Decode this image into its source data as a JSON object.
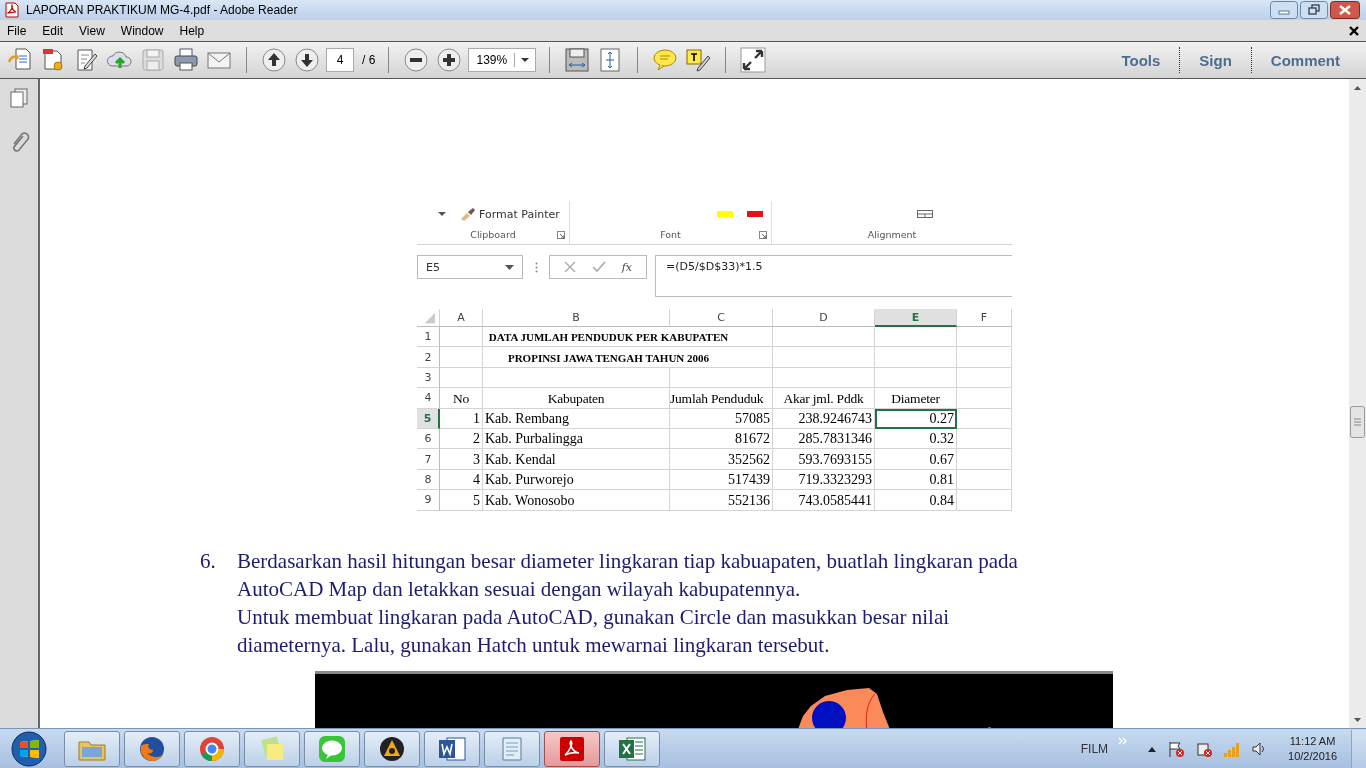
{
  "window": {
    "title": "LAPORAN PRAKTIKUM MG-4.pdf - Adobe Reader"
  },
  "menu": [
    "File",
    "Edit",
    "View",
    "Window",
    "Help"
  ],
  "toolbar": {
    "page": "4",
    "page_total": "/ 6",
    "zoom": "139%",
    "panes": [
      "Tools",
      "Sign",
      "Comment"
    ]
  },
  "document": {
    "spreadsheet": {
      "ribbon": {
        "clipboard_button": "Format Painter",
        "groups": [
          "Clipboard",
          "Font",
          "Alignment"
        ]
      },
      "name_box": "E5",
      "function_label": "fx",
      "formula": "=(D5/$D$33)*1.5",
      "columns": [
        {
          "label": "A",
          "selected": false
        },
        {
          "label": "B",
          "selected": false
        },
        {
          "label": "C",
          "selected": false
        },
        {
          "label": "D",
          "selected": false
        },
        {
          "label": "E",
          "selected": true
        },
        {
          "label": "F",
          "selected": false
        }
      ],
      "rows": [
        {
          "header": "1",
          "kind": "title",
          "selected": false,
          "text": "DATA JUMLAH PENDUDUK PER KABUPATEN"
        },
        {
          "header": "2",
          "kind": "title",
          "selected": false,
          "text": "PROPINSI JAWA TENGAH TAHUN 2006"
        },
        {
          "header": "3",
          "kind": "blank",
          "selected": false
        },
        {
          "header": "4",
          "kind": "heading",
          "selected": false,
          "cells": [
            "No",
            "Kabupaten",
            "Jumlah Penduduk",
            "Akar jml. Pddk",
            "Diameter"
          ]
        },
        {
          "header": "5",
          "kind": "data",
          "selected": true,
          "cells": [
            "1",
            "Kab. Rembang",
            "57085",
            "238.9246743",
            "0.27"
          ]
        },
        {
          "header": "6",
          "kind": "data",
          "selected": false,
          "cells": [
            "2",
            "Kab. Purbalingga",
            "81672",
            "285.7831346",
            "0.32"
          ]
        },
        {
          "header": "7",
          "kind": "data",
          "selected": false,
          "cells": [
            "3",
            "Kab. Kendal",
            "352562",
            "593.7693155",
            "0.67"
          ]
        },
        {
          "header": "8",
          "kind": "data",
          "selected": false,
          "cells": [
            "4",
            "Kab. Purworejo",
            "517439",
            "719.3323293",
            "0.81"
          ]
        },
        {
          "header": "9",
          "kind": "data",
          "selected": false,
          "cells": [
            "5",
            "Kab. Wonosobo",
            "552136",
            "743.0585441",
            "0.84"
          ]
        }
      ]
    },
    "list_item": {
      "number": "6.",
      "paragraphs": [
        [
          "Berdasarkan hasil hitungan besar diameter lingkaran tiap kabuapaten, buatlah lingkaran pada",
          "AutoCAD Map dan letakkan sesuai dengan wilayah kabupatennya."
        ],
        [
          "Untuk membuat lingkaran pada AutoCAD, gunakan Circle dan masukkan besar nilai",
          "diameternya. Lalu, gunakan Hatch untuk mewarnai lingkaran tersebut."
        ]
      ]
    }
  },
  "taskbar": {
    "apps": [
      {
        "kind": "folder",
        "selected": false
      },
      {
        "kind": "firefox",
        "selected": false
      },
      {
        "kind": "chrome",
        "selected": false
      },
      {
        "kind": "notes",
        "selected": false
      },
      {
        "kind": "chat",
        "selected": false
      },
      {
        "kind": "player",
        "selected": false
      },
      {
        "kind": "word",
        "selected": false
      },
      {
        "kind": "notepad",
        "selected": false
      },
      {
        "kind": "acrobat",
        "selected": true
      },
      {
        "kind": "excel",
        "selected": false
      }
    ],
    "tray_label": "FILM",
    "time": "11:12 AM",
    "date": "10/2/2016"
  }
}
